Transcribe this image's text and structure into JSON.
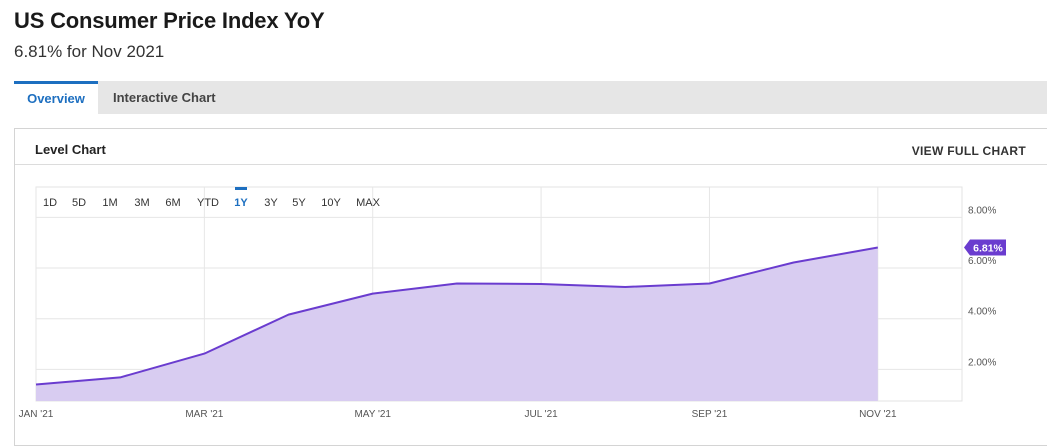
{
  "header": {
    "title": "US Consumer Price Index YoY",
    "subtitle": "6.81% for Nov 2021"
  },
  "tabs": [
    {
      "label": "Overview",
      "active": true
    },
    {
      "label": "Interactive Chart",
      "active": false
    }
  ],
  "panel": {
    "title": "Level Chart",
    "view_full_label": "VIEW FULL CHART"
  },
  "range_buttons": [
    "1D",
    "5D",
    "1M",
    "3M",
    "6M",
    "YTD",
    "1Y",
    "3Y",
    "5Y",
    "10Y",
    "MAX"
  ],
  "active_range": "1Y",
  "colors": {
    "accent": "#1d6fc0",
    "line": "#6a3ccf",
    "fill": "#d8ccf1",
    "badge": "#6a3ccf"
  },
  "chart_data": {
    "type": "area",
    "x": [
      "2021-01",
      "2021-02",
      "2021-03",
      "2021-04",
      "2021-05",
      "2021-06",
      "2021-07",
      "2021-08",
      "2021-09",
      "2021-10",
      "2021-11",
      "2021-12"
    ],
    "series": [
      {
        "values": [
          1.4,
          1.68,
          2.62,
          4.16,
          4.99,
          5.39,
          5.37,
          5.25,
          5.39,
          6.22,
          6.81
        ]
      }
    ],
    "x_tick_labels": [
      "JAN '21",
      "MAR '21",
      "MAY '21",
      "JUL '21",
      "SEP '21",
      "NOV '21"
    ],
    "y_ticks": [
      2,
      4,
      6,
      8
    ],
    "y_tick_labels": [
      "2.00%",
      "4.00%",
      "6.00%",
      "8.00%"
    ],
    "last_value_label": "6.81%",
    "ylim": [
      0.75,
      9.2
    ],
    "grid": true,
    "y_axis_side": "right"
  }
}
